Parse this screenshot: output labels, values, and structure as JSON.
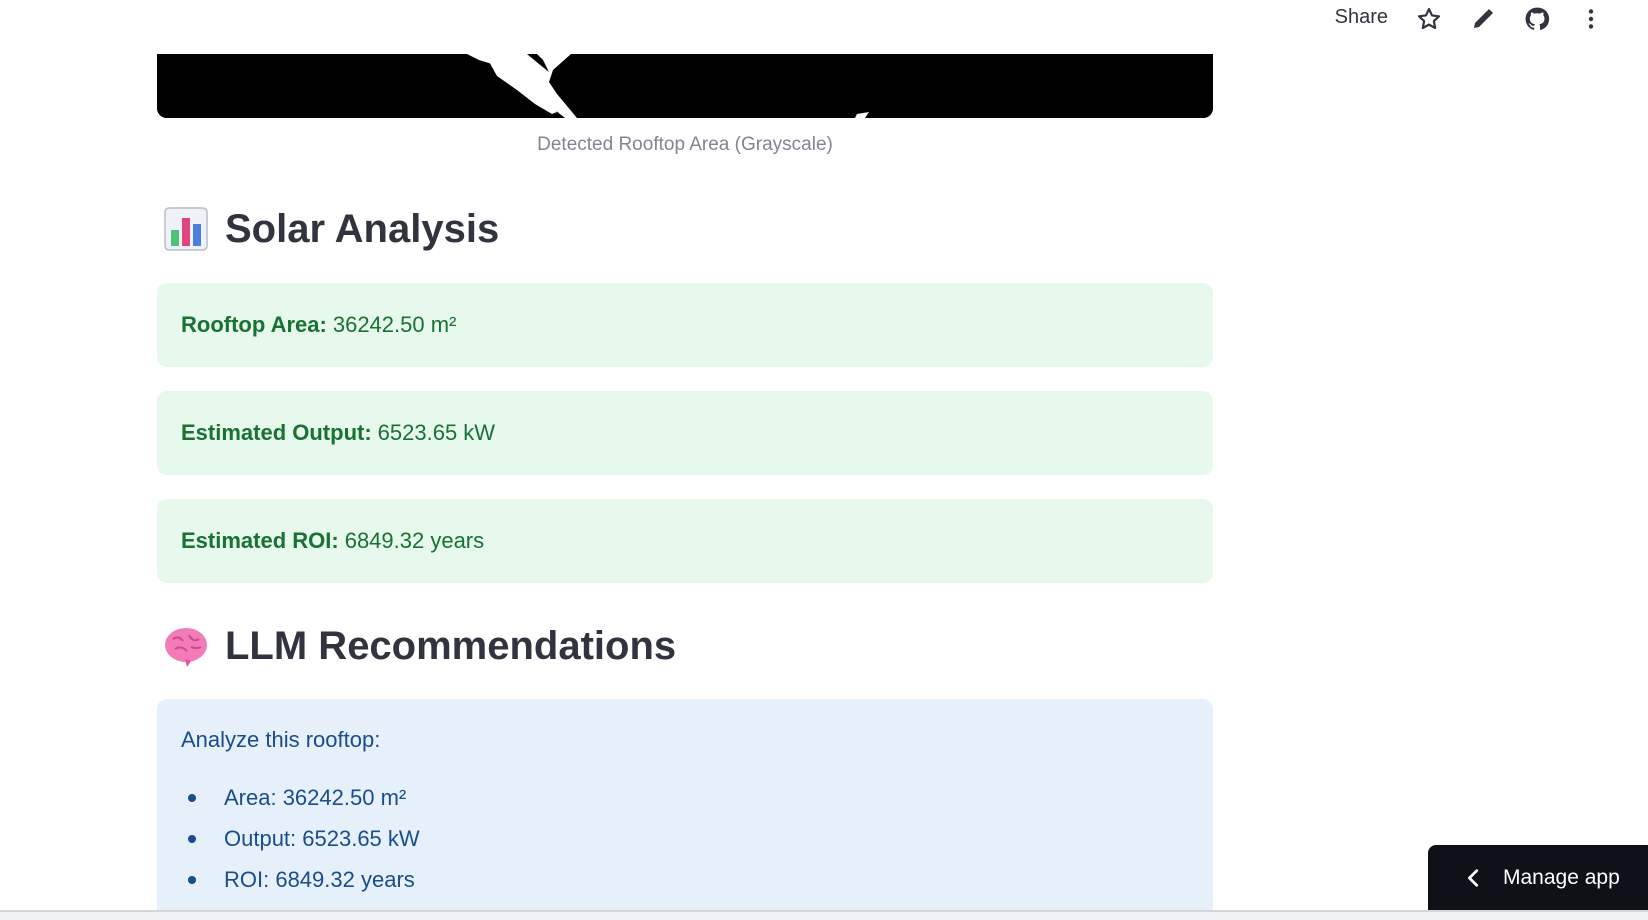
{
  "toolbar": {
    "share_label": "Share",
    "icons": [
      "star-icon",
      "pencil-icon",
      "github-icon",
      "more-vert-icon"
    ]
  },
  "image": {
    "caption": "Detected Rooftop Area (Grayscale)"
  },
  "solar_section": {
    "emoji": "bar-chart-emoji",
    "title": "Solar Analysis",
    "metrics": [
      {
        "label": "Rooftop Area:",
        "value": "36242.50 m²"
      },
      {
        "label": "Estimated Output:",
        "value": "6523.65 kW"
      },
      {
        "label": "Estimated ROI:",
        "value": "6849.32 years"
      }
    ]
  },
  "llm_section": {
    "emoji": "brain-emoji",
    "title": "LLM Recommendations",
    "intro": "Analyze this rooftop:",
    "items": [
      "Area: 36242.50 m²",
      "Output: 6523.65 kW",
      "ROI: 6849.32 years"
    ]
  },
  "manage_app": {
    "label": "Manage app"
  },
  "colors": {
    "success_bg": "#e7f8ec",
    "success_text": "#177233",
    "info_bg": "#e6f0fb",
    "info_text": "#1a4d8c",
    "manage_bg": "#0e1117"
  }
}
